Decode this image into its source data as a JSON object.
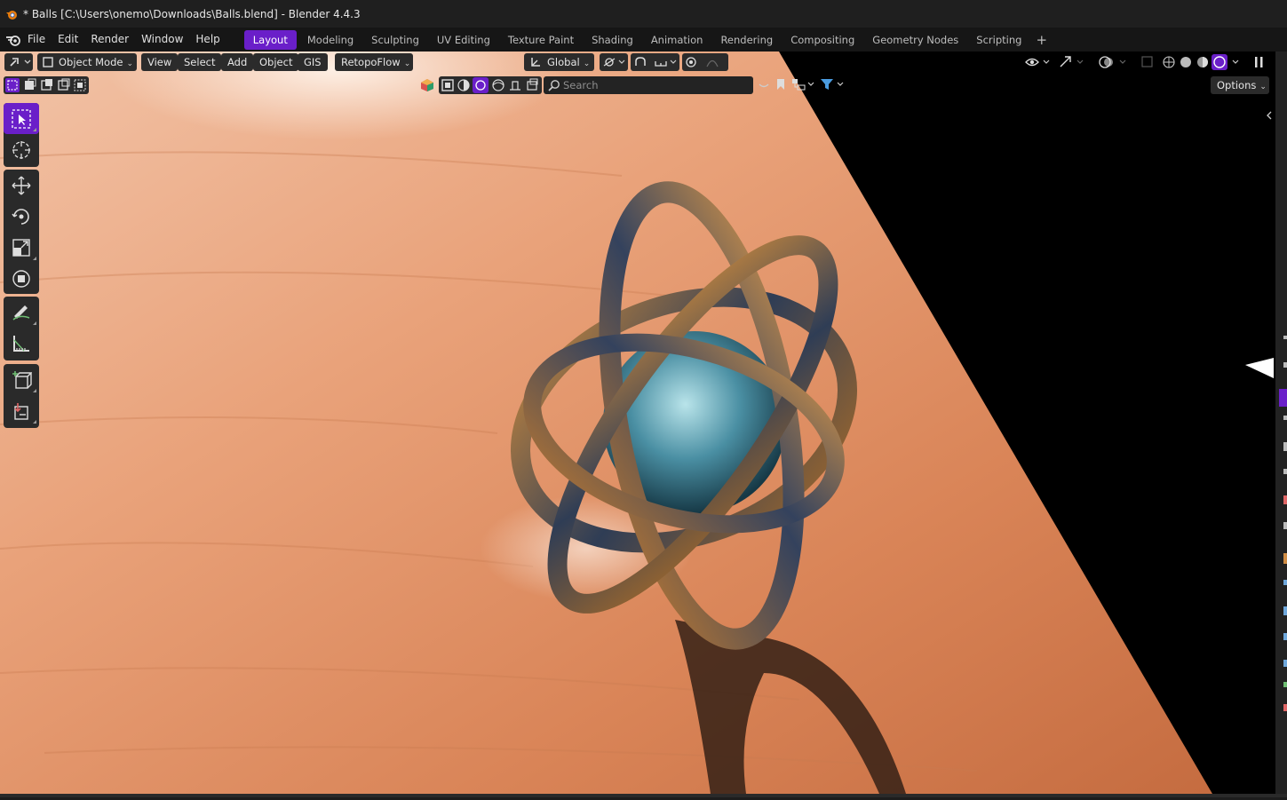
{
  "window": {
    "title": "* Balls [C:\\Users\\onemo\\Downloads\\Balls.blend] - Blender 4.4.3"
  },
  "menubar": {
    "items": [
      "File",
      "Edit",
      "Render",
      "Window",
      "Help"
    ],
    "tabs": [
      "Layout",
      "Modeling",
      "Sculpting",
      "UV Editing",
      "Texture Paint",
      "Shading",
      "Animation",
      "Rendering",
      "Compositing",
      "Geometry Nodes",
      "Scripting"
    ],
    "active_tab": "Layout",
    "add_tab_icon": "plus-icon"
  },
  "viewport_header": {
    "mode": "Object Mode",
    "menus": [
      "View",
      "Select",
      "Add",
      "Object",
      "GIS"
    ],
    "addon_menu": "RetopoFlow",
    "transform_orientation": "Global",
    "options_label": "Options"
  },
  "search": {
    "placeholder": "Search"
  },
  "toolbar": {
    "tools": [
      "select-box-icon",
      "cursor-icon",
      "move-icon",
      "rotate-icon",
      "scale-icon",
      "transform-icon",
      "annotate-icon",
      "measure-icon",
      "add-cube-icon",
      "extract-icon"
    ],
    "active_tool": "select-box-icon"
  },
  "colors": {
    "accent": "#6a1fc9",
    "header_button": "#2b2b2b",
    "background": "#1d1d1d"
  }
}
